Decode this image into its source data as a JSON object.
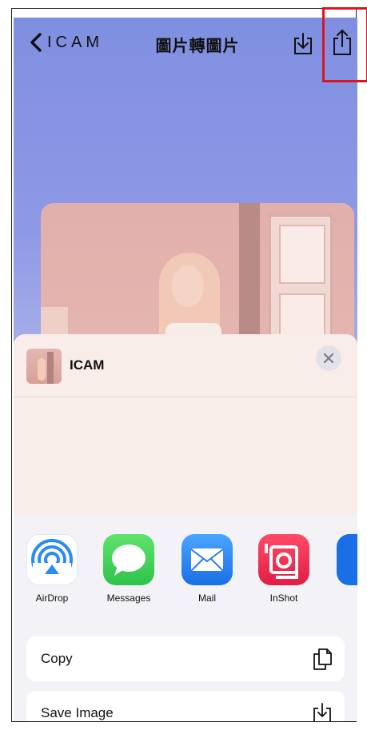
{
  "nav": {
    "back_label": "ICAM",
    "title": "圖片轉圖片"
  },
  "share_sheet": {
    "app_name": "ICAM",
    "apps": [
      {
        "label": "AirDrop",
        "icon": "airdrop-icon",
        "color": "#2a8bf2"
      },
      {
        "label": "Messages",
        "icon": "messages-icon",
        "color": "#35c759"
      },
      {
        "label": "Mail",
        "icon": "mail-icon",
        "color": "#2a7df0"
      },
      {
        "label": "InShot",
        "icon": "inshot-icon",
        "color": "#f0304e"
      }
    ],
    "actions": [
      {
        "label": "Copy",
        "icon": "copy-icon"
      },
      {
        "label": "Save Image",
        "icon": "save-image-icon"
      }
    ]
  },
  "colors": {
    "highlight": "#e0141e",
    "sky_top": "#7f8fe0",
    "sheet_background": "#f3f2f7"
  }
}
